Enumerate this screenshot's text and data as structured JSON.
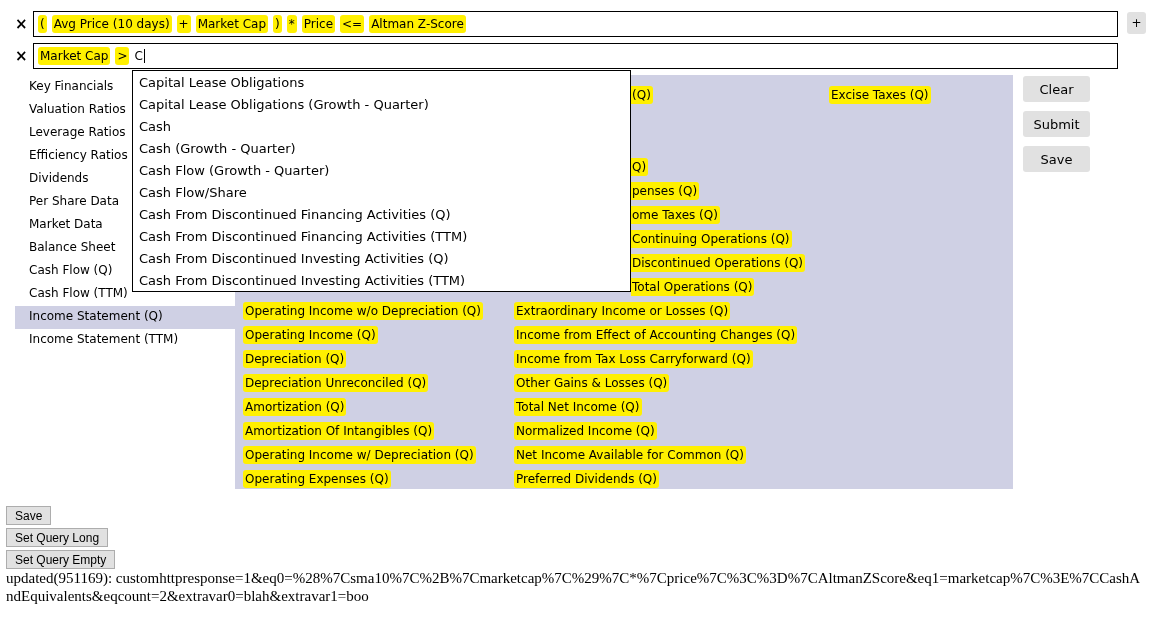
{
  "add_button": "+",
  "queries": [
    {
      "remove": "×",
      "tokens": [
        "(",
        "Avg Price (10 days)",
        "+",
        "Market Cap",
        ")",
        "*",
        "Price",
        "<=",
        "Altman Z-Score"
      ]
    },
    {
      "remove": "×",
      "tokens": [
        "Market Cap",
        ">"
      ],
      "value": "C"
    }
  ],
  "autocomplete": {
    "options": [
      "Capital Lease Obligations",
      "Capital Lease Obligations (Growth - Quarter)",
      "Cash",
      "Cash (Growth - Quarter)",
      "Cash Flow (Growth - Quarter)",
      "Cash Flow/Share",
      "Cash From Discontinued Financing Activities (Q)",
      "Cash From Discontinued Financing Activities (TTM)",
      "Cash From Discontinued Investing Activities (Q)",
      "Cash From Discontinued Investing Activities (TTM)"
    ]
  },
  "categories": [
    {
      "label": "Key Financials",
      "selected": false
    },
    {
      "label": "Valuation Ratios",
      "selected": false
    },
    {
      "label": "Leverage Ratios",
      "selected": false
    },
    {
      "label": "Efficiency Ratios",
      "selected": false
    },
    {
      "label": "Dividends",
      "selected": false
    },
    {
      "label": "Per Share Data",
      "selected": false
    },
    {
      "label": "Market Data",
      "selected": false
    },
    {
      "label": "Balance Sheet",
      "selected": false
    },
    {
      "label": "Cash Flow (Q)",
      "selected": false
    },
    {
      "label": "Cash Flow (TTM)",
      "selected": false
    },
    {
      "label": "Income Statement (Q)",
      "selected": true
    },
    {
      "label": "Income Statement (TTM)",
      "selected": false
    }
  ],
  "fields_panel": {
    "rows": [
      {
        "column_2": {
          "text": "(Q)",
          "clipped": true
        },
        "column_3": {
          "text": "Excise Taxes (Q)",
          "clipped": false
        }
      },
      {},
      {},
      {
        "column_2": {
          "text": "Q)",
          "clipped": true
        }
      },
      {
        "column_2": {
          "text": "penses (Q)",
          "clipped": true
        }
      },
      {
        "column_2": {
          "text": "ome Taxes (Q)",
          "clipped": true
        }
      },
      {
        "column_2": {
          "text": "Continuing Operations (Q)",
          "clipped": true
        }
      },
      {
        "column_2": {
          "text": "Discontinued Operations (Q)",
          "clipped": true
        }
      },
      {
        "column_2": {
          "text": "Total Operations (Q)",
          "clipped": true
        }
      },
      {
        "column_1": {
          "text": "Operating Income w/o Depreciation (Q)",
          "clipped": false
        },
        "column_2": {
          "text": "Extraordinary Income or Losses (Q)",
          "clipped": false
        }
      },
      {
        "column_1": {
          "text": "Operating Income (Q)",
          "clipped": false
        },
        "column_2": {
          "text": "Income from Effect of Accounting Changes (Q)",
          "clipped": false
        }
      },
      {
        "column_1": {
          "text": "Depreciation (Q)",
          "clipped": false
        },
        "column_2": {
          "text": "Income from Tax Loss Carryforward (Q)",
          "clipped": false
        }
      },
      {
        "column_1": {
          "text": "Depreciation Unreconciled (Q)",
          "clipped": false
        },
        "column_2": {
          "text": "Other Gains & Losses (Q)",
          "clipped": false
        }
      },
      {
        "column_1": {
          "text": "Amortization (Q)",
          "clipped": false
        },
        "column_2": {
          "text": "Total Net Income (Q)",
          "clipped": false
        }
      },
      {
        "column_1": {
          "text": "Amortization Of Intangibles (Q)",
          "clipped": false
        },
        "column_2": {
          "text": "Normalized Income (Q)",
          "clipped": false
        }
      },
      {
        "column_1": {
          "text": "Operating Income w/ Depreciation (Q)",
          "clipped": false
        },
        "column_2": {
          "text": "Net Income Available for Common (Q)",
          "clipped": false
        }
      },
      {
        "column_1": {
          "text": "Operating Expenses (Q)",
          "clipped": false
        },
        "column_2": {
          "text": "Preferred Dividends (Q)",
          "clipped": false
        }
      }
    ]
  },
  "actions": [
    "Clear",
    "Submit",
    "Save"
  ],
  "debug_buttons": [
    "Save",
    "Set Query Long",
    "Set Query Empty"
  ],
  "status_text": "updated(951169): customhttpresponse=1&eq0=%28%7Csma10%7C%2B%7Cmarketcap%7C%29%7C*%7Cprice%7C%3C%3D%7CAltmanZScore&eq1=marketcap%7C%3E%7CCashAndEquivalents&eqcount=2&extravar0=blah&extravar1=boo"
}
